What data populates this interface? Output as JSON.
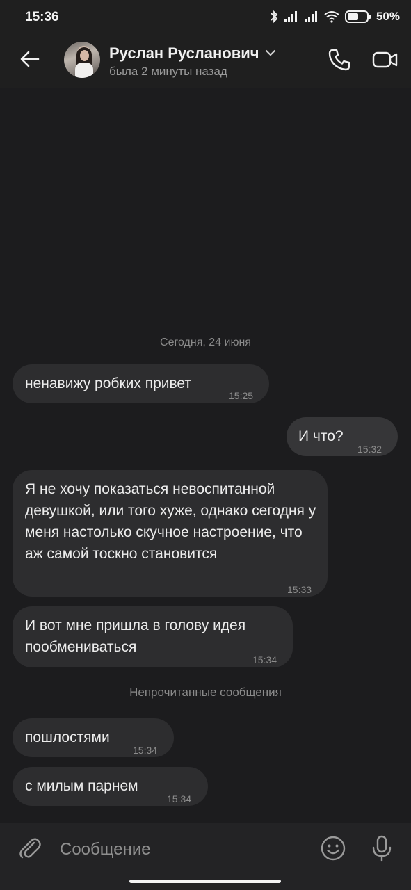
{
  "status_bar": {
    "time": "15:36",
    "battery_percent": "50%",
    "icons": [
      "bluetooth-icon",
      "signal-icon",
      "signal-icon",
      "wifi-icon",
      "battery-icon"
    ]
  },
  "header": {
    "contact_name": "Руслан Русланович",
    "contact_status": "была 2 минуты назад",
    "icons": [
      "back-arrow-icon",
      "chevron-down-icon",
      "phone-icon",
      "video-camera-icon"
    ]
  },
  "chat": {
    "date_separator": "Сегодня, 24 июня",
    "unread_separator": "Непрочитанные сообщения",
    "messages": [
      {
        "direction": "in",
        "text": "ненавижу робких привет",
        "time": "15:25"
      },
      {
        "direction": "out",
        "text": "И что?",
        "time": "15:32"
      },
      {
        "direction": "in",
        "text": "Я не хочу показаться невоспитанной девушкой, или того хуже, однако сегодня у меня настолько скучное настроение, что аж самой тоскно становится",
        "time": "15:33"
      },
      {
        "direction": "in",
        "text": "И вот мне пришла в голову идея пообмениваться",
        "time": "15:34"
      },
      {
        "direction": "in",
        "text": "пошлостями",
        "time": "15:34"
      },
      {
        "direction": "in",
        "text": "с милым парнем",
        "time": "15:34"
      }
    ]
  },
  "composer": {
    "placeholder": "Сообщение",
    "icons": [
      "paperclip-icon",
      "emoji-icon",
      "microphone-icon"
    ]
  },
  "colors": {
    "background": "#1c1c1e",
    "bubble_incoming": "#2d2d2f",
    "bubble_outgoing": "#363638",
    "text_primary": "#ececec",
    "text_secondary": "#8a8a8a"
  }
}
